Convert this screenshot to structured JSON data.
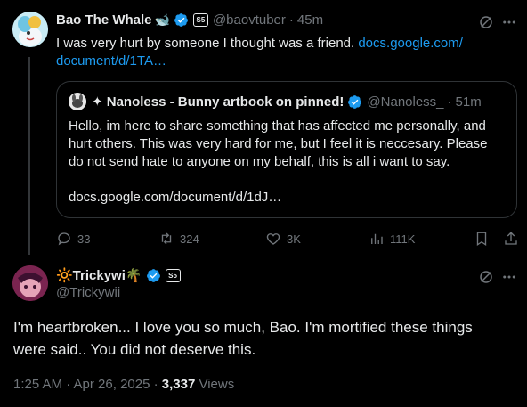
{
  "tweet1": {
    "display_name": "Bao The Whale",
    "name_emoji": "🐋",
    "handle": "@baovtuber",
    "separator": "·",
    "time": "45m",
    "text": "I was very hurt by someone I thought was a friend.",
    "link_line1": "docs.google.com/",
    "link_line2": "document/d/1TA…",
    "actions": {
      "replies": "33",
      "reposts": "324",
      "likes": "3K",
      "views": "111K"
    }
  },
  "quote": {
    "display_name": "✦ Nanoless - Bunny artbook on pinned!",
    "handle": "@Nanoless_",
    "separator": "·",
    "time": "51m",
    "line1": "Hello, im here to share something that has affected me personally, and",
    "line2": "hurt others. This was very hard for me, but I feel it is neccesary. Please",
    "line3": "do not send hate to anyone on my behalf, this is all i want to say.",
    "link": "docs.google.com/document/d/1dJ…"
  },
  "tweet2": {
    "display_name": "🔆Trickywi🌴",
    "handle": "@Trickywii",
    "line1": "I'm heartbroken... I love you so much, Bao. I'm mortified these things",
    "line2": "were said.. You did not deserve this.",
    "timestamp": "1:25 AM · Apr 26, 2025 · ",
    "views_count": "3,337",
    "views_label": " Views"
  },
  "colors": {
    "background": "#000000",
    "text": "#e7e9ea",
    "muted": "#71767b",
    "link": "#1d9bf0",
    "verified": "#1d9bf0",
    "border": "#2f3336"
  },
  "icons": [
    "grok-icon",
    "more-icon",
    "verified-icon",
    "affiliate-badge-icon",
    "reply-icon",
    "repost-icon",
    "like-icon",
    "views-icon",
    "bookmark-icon",
    "share-icon"
  ]
}
